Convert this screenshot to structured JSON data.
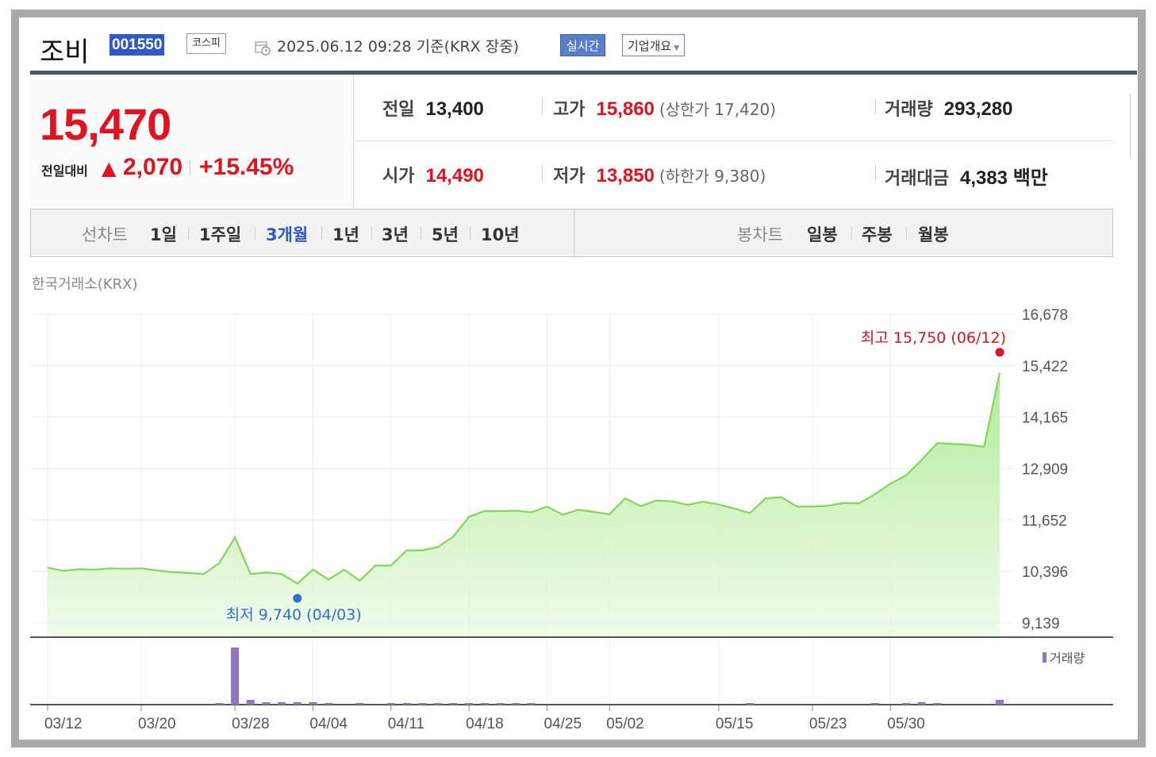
{
  "header": {
    "stock_name": "조비",
    "stock_code": "001550",
    "market": "코스피",
    "datetime": "2025.06.12 09:28  기준(KRX 장중)",
    "realtime_label": "실시간",
    "company_label": "기업개요"
  },
  "summary": {
    "price": "15,470",
    "change_label": "전일대비",
    "change_arrow": "▲",
    "change_amount": "2,070",
    "change_pct": "+15.45%",
    "prev_label": "전일",
    "prev_value": "13,400",
    "high_label": "고가",
    "high_value": "15,860",
    "upper_limit": "(상한가 17,420)",
    "volume_label": "거래량",
    "volume_value": "293,280",
    "open_label": "시가",
    "open_value": "14,490",
    "low_label": "저가",
    "low_value": "13,850",
    "lower_limit": "(하한가 9,380)",
    "amount_label": "거래대금",
    "amount_value": "4,383 백만"
  },
  "tabs": {
    "line_group": "선차트",
    "line_items": [
      "1일",
      "1주일",
      "3개월",
      "1년",
      "3년",
      "5년",
      "10년"
    ],
    "active": "3개월",
    "candle_group": "봉차트",
    "candle_items": [
      "일봉",
      "주봉",
      "월봉"
    ]
  },
  "exchange_label": "한국거래소(KRX)",
  "colors": {
    "up": "#e4121e",
    "accent": "#2f58c8",
    "line": "#7ed957",
    "volume": "#8f74c9"
  },
  "chart_data": {
    "type": "area",
    "ylim": [
      9139,
      16678
    ],
    "y_ticks": [
      "16,678",
      "15,422",
      "14,165",
      "12,909",
      "11,652",
      "10,396",
      "9,139"
    ],
    "y_tick_values": [
      16678,
      15422,
      14165,
      12909,
      11652,
      10396,
      9139
    ],
    "x_tick_labels": [
      "03/12",
      "03/20",
      "03/28",
      "04/04",
      "04/11",
      "04/18",
      "04/25",
      "05/02",
      "05/15",
      "05/23",
      "05/30"
    ],
    "x_tick_index": [
      0,
      6,
      12,
      17,
      22,
      27,
      32,
      36,
      43,
      49,
      54
    ],
    "series": [
      {
        "values": [
          10490,
          10410,
          10450,
          10440,
          10470,
          10460,
          10470,
          10420,
          10380,
          10360,
          10330,
          10600,
          11230,
          10330,
          10370,
          10330,
          10100,
          10440,
          10200,
          10440,
          10170,
          10540,
          10540,
          10910,
          10910,
          10990,
          11250,
          11730,
          11870,
          11870,
          11880,
          11840,
          11980,
          11780,
          11900,
          11850,
          11790,
          12180,
          11990,
          12130,
          12110,
          12020,
          12100,
          12030,
          11930,
          11820,
          12180,
          12210,
          11980,
          11980,
          12000,
          12070,
          12060,
          12280,
          12540,
          12740,
          13120,
          13530,
          13510,
          13490,
          13440,
          15250
        ]
      }
    ],
    "volume": {
      "legend": "거래량",
      "values": [
        0,
        0,
        0,
        0,
        0,
        0,
        0,
        0,
        0,
        0,
        0,
        2,
        72,
        6,
        3,
        3,
        3,
        3,
        2,
        0,
        2,
        0,
        2,
        2,
        2,
        2,
        2,
        2,
        2,
        2,
        2,
        2,
        0,
        0,
        0,
        0,
        0,
        0,
        0,
        0,
        0,
        0,
        0,
        0,
        0,
        2,
        0,
        0,
        0,
        0,
        0,
        0,
        0,
        2,
        0,
        2,
        3,
        2,
        0,
        0,
        0,
        6
      ]
    },
    "max_label": "최고 15,750 (06/12)",
    "max_value": 15750,
    "max_index": 61,
    "min_label": "최저 9,740 (04/03)",
    "min_value": 9740,
    "min_index": 16
  }
}
